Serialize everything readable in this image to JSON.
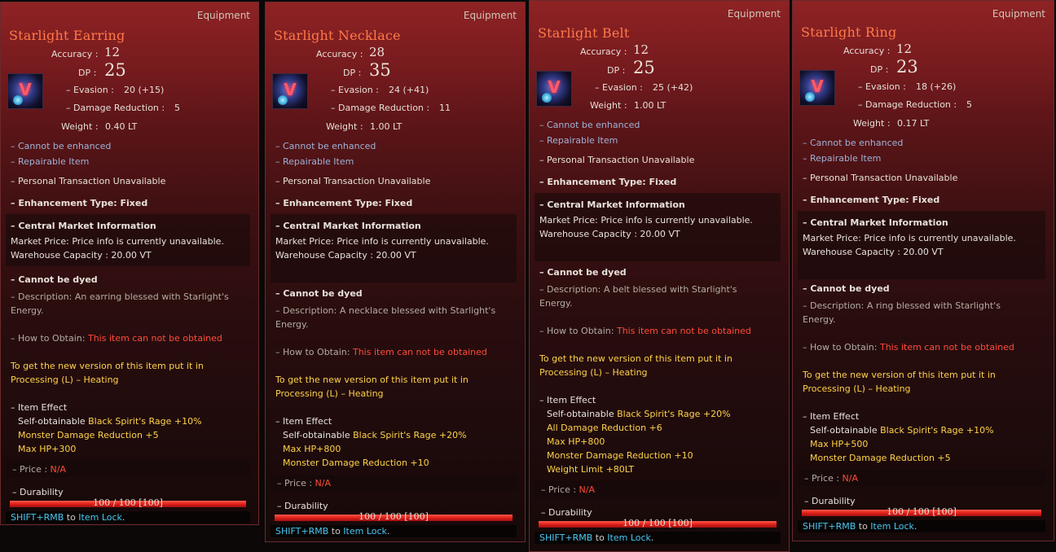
{
  "common": {
    "tag": "Equipment",
    "accuracy_label": "Accuracy :",
    "dp_label": "DP :",
    "evasion_label": "– Evasion :",
    "dr_label": "– Damage Reduction :",
    "weight_label": "Weight :",
    "cannot_enhance": "– Cannot be enhanced",
    "repairable": "– Repairable Item",
    "personal_trans": "– Personal Transaction Unavailable",
    "enh_type": "– Enhancement Type: Fixed",
    "cmi": "– Central Market Information",
    "market_price": "Market Price: Price info is currently unavailable.",
    "warehouse": "Warehouse Capacity : 20.00 VT",
    "cannot_dye": "– Cannot be dyed",
    "how_obtain_label": "– How to Obtain:",
    "how_obtain_value": "This item can not be obtained",
    "new_version_1": "To get the new version of this item put it in",
    "new_version_2": "Processing (L) – Heating",
    "item_effect": "– Item Effect",
    "self_obtainable": "Self-obtainable",
    "price_label": "– Price :",
    "price_value": "N/A",
    "durability_label": "– Durability",
    "durability_value": "100 / 100 [100]",
    "footer_key": "SHIFT+RMB",
    "footer_to": "to",
    "footer_action": "Item Lock",
    "footer_end": ".",
    "icon_glyph": "V",
    "colors": {
      "title": "#ff7a4a",
      "blue_text": "#9fb2d6",
      "red_text": "#ff4a3a",
      "yellow_text": "#ffd24a",
      "cyan_text": "#4ac8f0",
      "bar": "#e0201a"
    }
  },
  "items": [
    {
      "name": "Starlight Earring",
      "accuracy": "12",
      "dp": "25",
      "evasion": "20 (+15)",
      "dr": "5",
      "weight": "0.40 LT",
      "description_1": "– Description: An earring blessed with Starlight's",
      "description_2": "Energy.",
      "effect_first": "Black Spirit's Rage +10%",
      "effects": [
        "Monster Damage Reduction +5",
        "Max HP+300"
      ],
      "durability_fraction": 1.0
    },
    {
      "name": "Starlight Necklace",
      "accuracy": "28",
      "dp": "35",
      "evasion": "24 (+41)",
      "dr": "11",
      "weight": "1.00 LT",
      "description_1": "– Description: A necklace blessed with Starlight's",
      "description_2": "Energy.",
      "effect_first": "Black Spirit's Rage +20%",
      "effects": [
        "Max HP+800",
        "Monster Damage Reduction +10"
      ],
      "durability_fraction": 1.0
    },
    {
      "name": "Starlight Belt",
      "accuracy": "12",
      "dp": "25",
      "evasion": "25 (+42)",
      "dr": "",
      "weight": "1.00 LT",
      "description_1": "– Description: A belt blessed with Starlight's",
      "description_2": "Energy.",
      "effect_first": "Black Spirit's Rage +20%",
      "effects": [
        "All Damage Reduction +6",
        "Max HP+800",
        "Monster Damage Reduction +10",
        "Weight Limit +80LT"
      ],
      "durability_fraction": 1.0
    },
    {
      "name": "Starlight Ring",
      "accuracy": "12",
      "dp": "23",
      "evasion": "18 (+26)",
      "dr": "5",
      "weight": "0.17 LT",
      "description_1": "– Description: A ring blessed with Starlight's",
      "description_2": "Energy.",
      "effect_first": "Black Spirit's Rage +10%",
      "effects": [
        "Max HP+500",
        "Monster Damage Reduction +5"
      ],
      "durability_fraction": 1.0
    }
  ]
}
